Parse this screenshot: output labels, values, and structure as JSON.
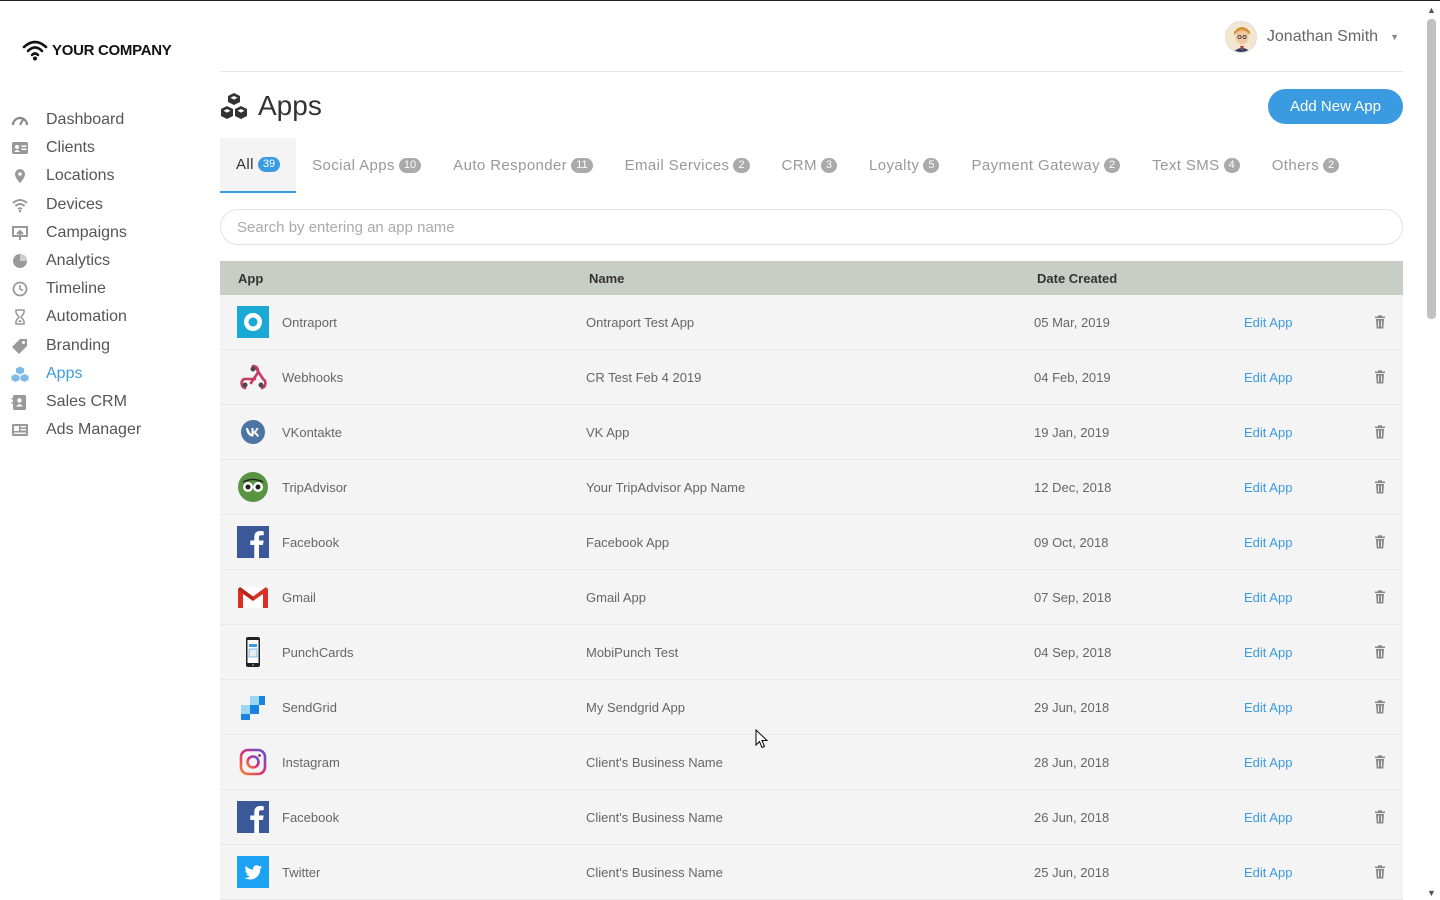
{
  "brand": {
    "name": "YOUR COMPANY"
  },
  "user": {
    "name": "Jonathan Smith"
  },
  "sidebar": {
    "items": [
      {
        "label": "Dashboard",
        "icon": "speedometer-icon"
      },
      {
        "label": "Clients",
        "icon": "id-card-icon"
      },
      {
        "label": "Locations",
        "icon": "map-pin-icon"
      },
      {
        "label": "Devices",
        "icon": "wifi-icon"
      },
      {
        "label": "Campaigns",
        "icon": "upload-screen-icon"
      },
      {
        "label": "Analytics",
        "icon": "pie-chart-icon"
      },
      {
        "label": "Timeline",
        "icon": "clock-icon"
      },
      {
        "label": "Automation",
        "icon": "hourglass-icon"
      },
      {
        "label": "Branding",
        "icon": "tag-icon"
      },
      {
        "label": "Apps",
        "icon": "cubes-icon",
        "active": true
      },
      {
        "label": "Sales CRM",
        "icon": "contact-book-icon"
      },
      {
        "label": "Ads Manager",
        "icon": "newspaper-icon"
      }
    ]
  },
  "page": {
    "title": "Apps",
    "add_button": "Add New App"
  },
  "tabs": [
    {
      "label": "All",
      "count": "39",
      "active": true
    },
    {
      "label": "Social Apps",
      "count": "10"
    },
    {
      "label": "Auto Responder",
      "count": "11"
    },
    {
      "label": "Email Services",
      "count": "2"
    },
    {
      "label": "CRM",
      "count": "3"
    },
    {
      "label": "Loyalty",
      "count": "5"
    },
    {
      "label": "Payment Gateway",
      "count": "2"
    },
    {
      "label": "Text SMS",
      "count": "4"
    },
    {
      "label": "Others",
      "count": "2"
    }
  ],
  "search": {
    "placeholder": "Search by entering an app name",
    "value": ""
  },
  "table": {
    "headers": {
      "app": "App",
      "name": "Name",
      "date": "Date Created"
    },
    "edit_label": "Edit App",
    "rows": [
      {
        "app": "Ontraport",
        "icon": "ontraport-icon",
        "name": "Ontraport Test App",
        "date": "05 Mar, 2019"
      },
      {
        "app": "Webhooks",
        "icon": "webhooks-icon",
        "name": "CR Test Feb 4 2019",
        "date": "04 Feb, 2019"
      },
      {
        "app": "VKontakte",
        "icon": "vk-icon",
        "name": "VK App",
        "date": "19 Jan, 2019"
      },
      {
        "app": "TripAdvisor",
        "icon": "tripadvisor-icon",
        "name": "Your TripAdvisor App Name",
        "date": "12 Dec, 2018"
      },
      {
        "app": "Facebook",
        "icon": "facebook-icon",
        "name": "Facebook App",
        "date": "09 Oct, 2018"
      },
      {
        "app": "Gmail",
        "icon": "gmail-icon",
        "name": "Gmail App",
        "date": "07 Sep, 2018"
      },
      {
        "app": "PunchCards",
        "icon": "punchcards-icon",
        "name": "MobiPunch Test",
        "date": "04 Sep, 2018"
      },
      {
        "app": "SendGrid",
        "icon": "sendgrid-icon",
        "name": "My Sendgrid App",
        "date": "29 Jun, 2018"
      },
      {
        "app": "Instagram",
        "icon": "instagram-icon",
        "name": "Client's Business Name",
        "date": "28 Jun, 2018"
      },
      {
        "app": "Facebook",
        "icon": "facebook-icon",
        "name": "Client's Business Name",
        "date": "26 Jun, 2018"
      },
      {
        "app": "Twitter",
        "icon": "twitter-icon",
        "name": "Client's Business Name",
        "date": "25 Jun, 2018"
      }
    ]
  },
  "colors": {
    "accent": "#3b9be0",
    "table_header": "#c8cec6",
    "row_bg": "#f4f4f4"
  }
}
